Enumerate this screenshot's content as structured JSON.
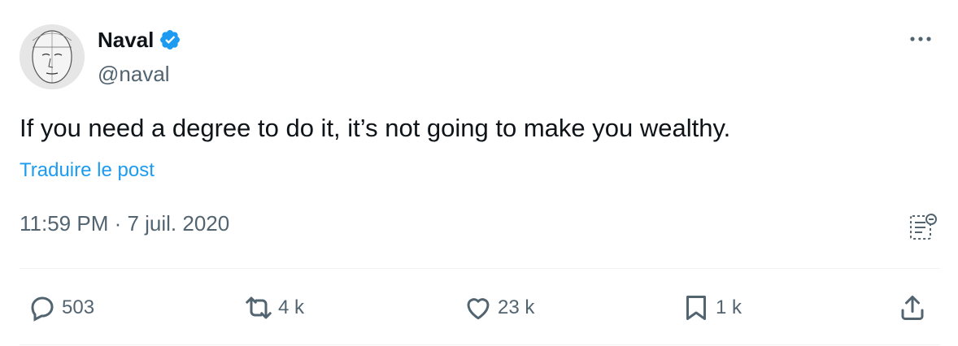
{
  "author": {
    "display_name": "Naval",
    "handle": "@naval",
    "verified": true
  },
  "tweet": {
    "text": "If you need a degree to do it, it’s not going to make you wealthy.",
    "translate_label": "Traduire le post",
    "timestamp": "11:59 PM · 7 juil. 2020"
  },
  "actions": {
    "replies": "503",
    "reposts": "4 k",
    "likes": "23 k",
    "bookmarks": "1 k"
  },
  "icons": {
    "more": "more-horizontal-icon",
    "analytics": "analytics-icon",
    "reply": "reply-bubble-icon",
    "repost": "repost-arrows-icon",
    "like": "heart-icon",
    "bookmark": "bookmark-icon",
    "share": "share-upload-icon",
    "verified": "verified-badge-icon"
  },
  "colors": {
    "primary_text": "#0f1419",
    "secondary_text": "#536471",
    "link": "#1d9bf0",
    "verified_badge": "#1d9bf0",
    "divider": "#eff3f4"
  }
}
